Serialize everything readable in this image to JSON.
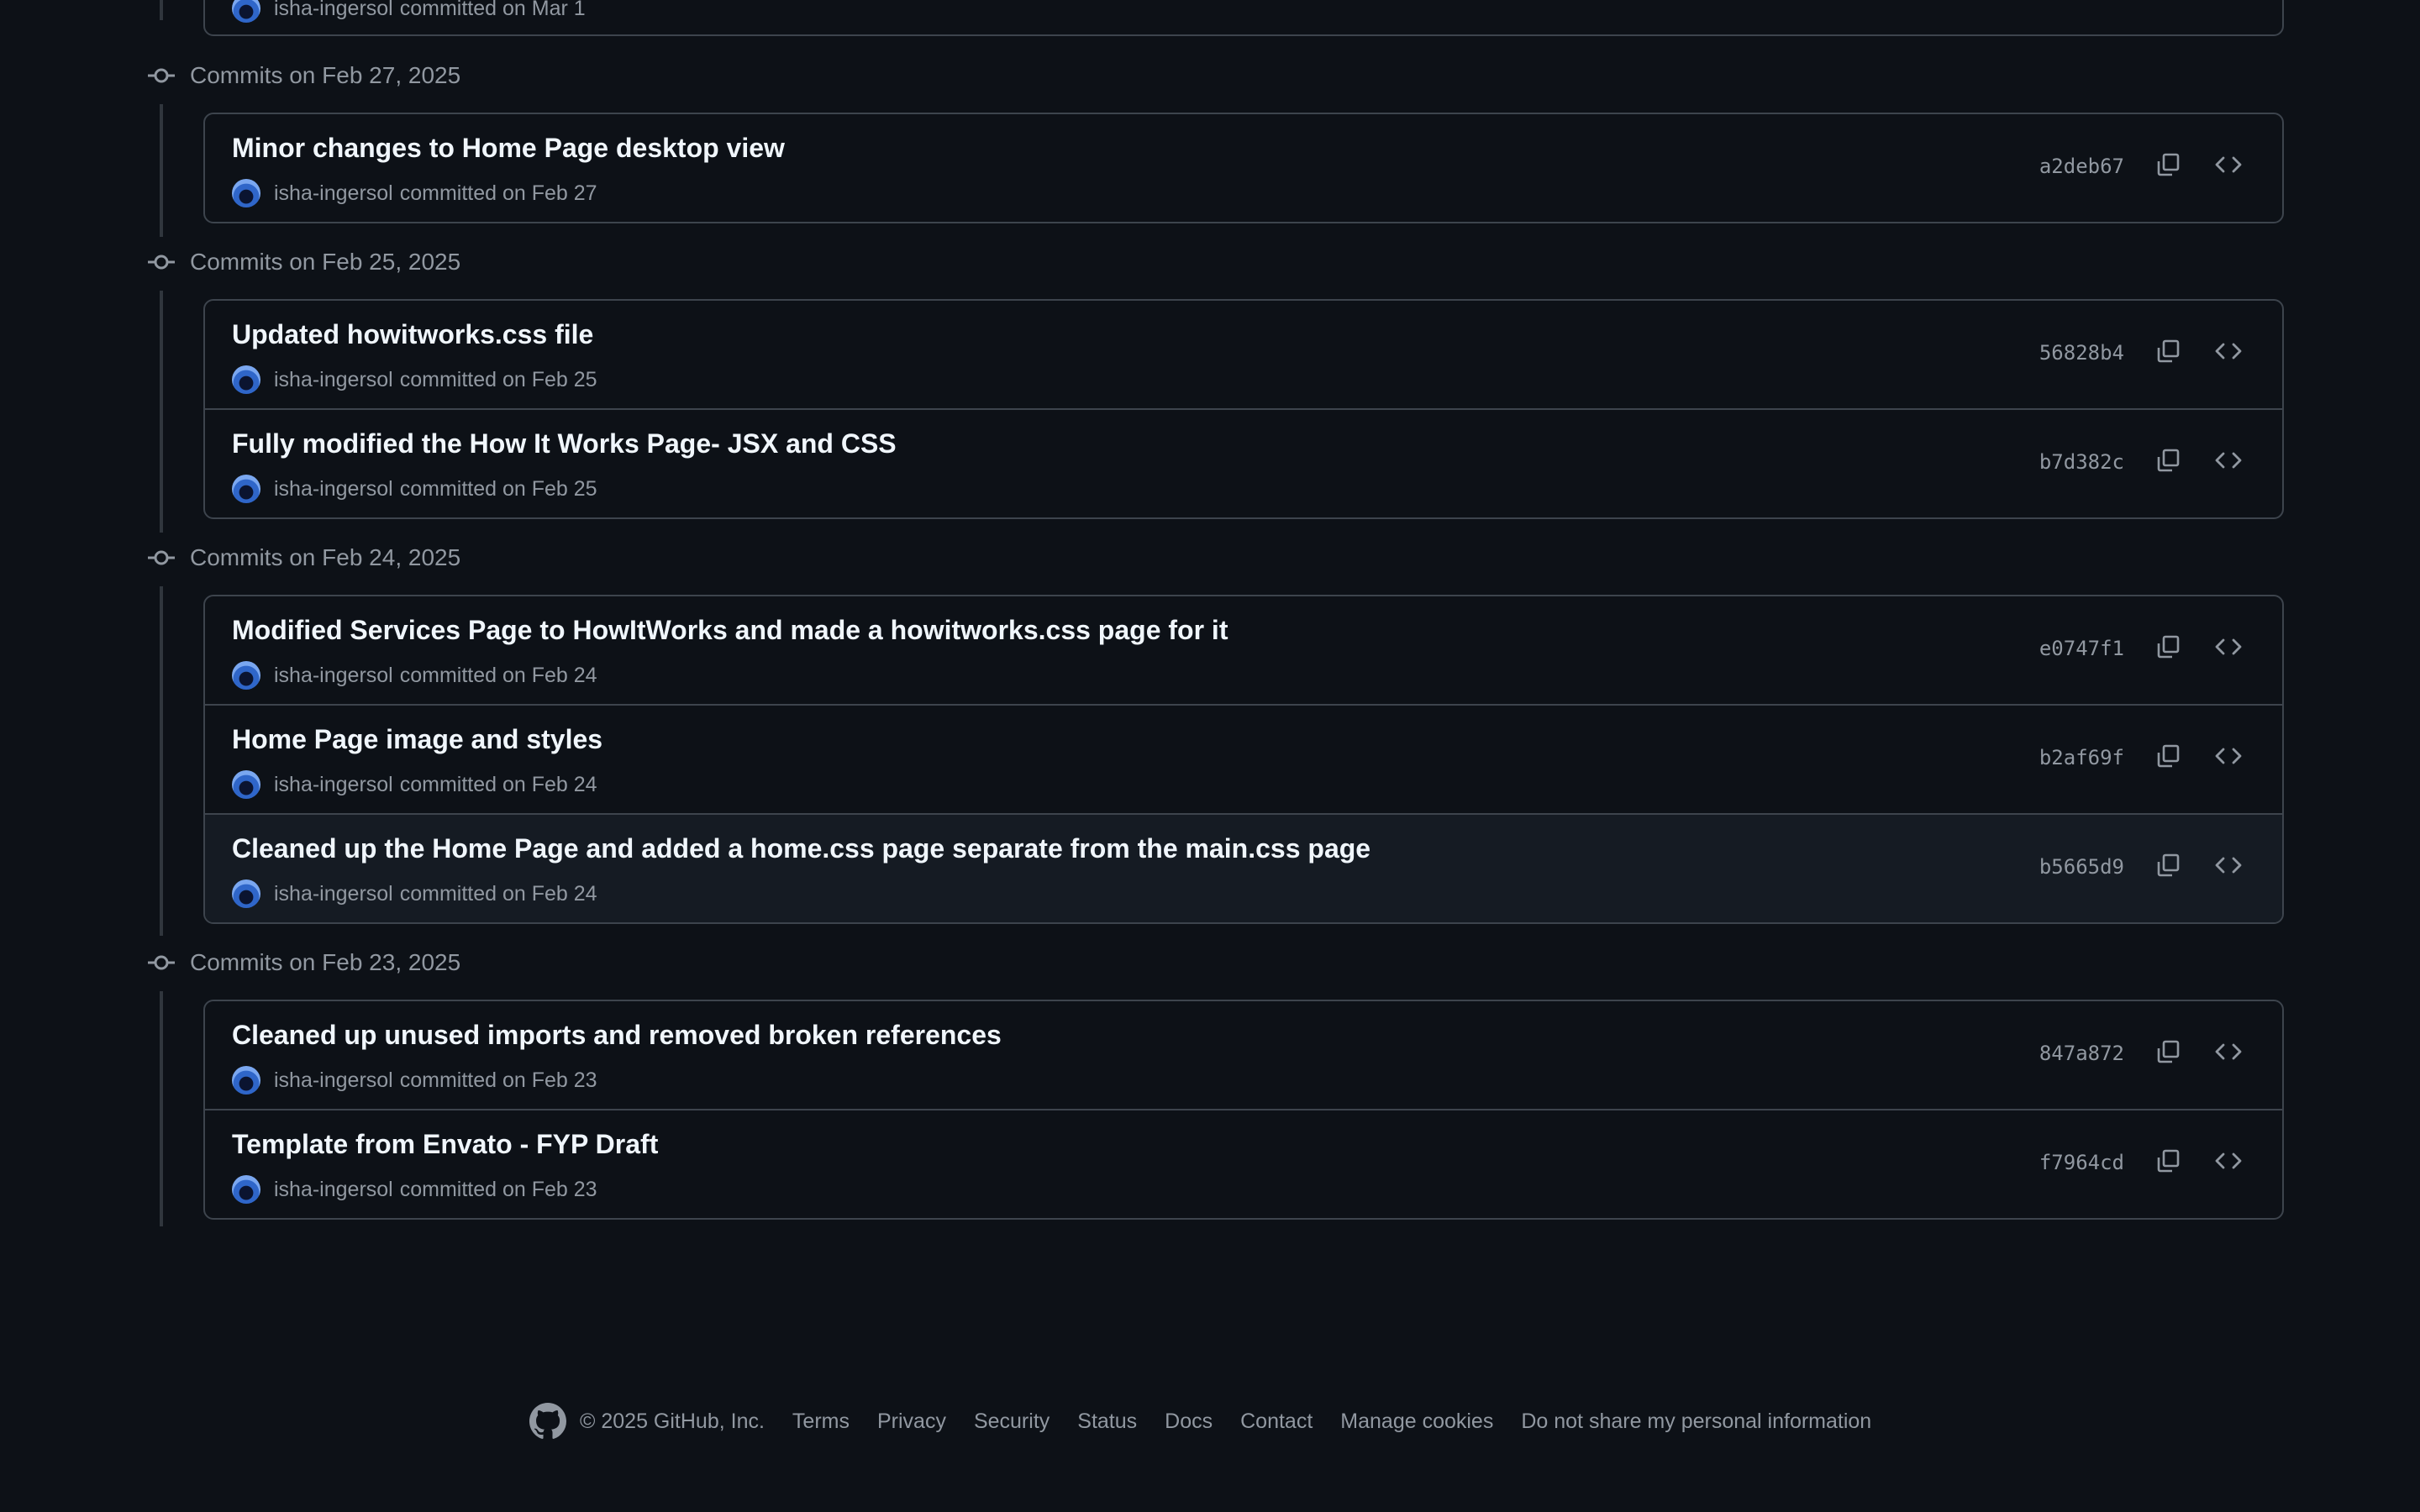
{
  "top_partial": {
    "author": "isha-ingersol",
    "committed_text": "committed on Mar 1"
  },
  "groups": [
    {
      "title": "Commits on Feb 27, 2025",
      "commits": [
        {
          "message": "Minor changes to Home Page desktop view",
          "author": "isha-ingersol",
          "committed_text": "committed on Feb 27",
          "sha": "a2deb67"
        }
      ]
    },
    {
      "title": "Commits on Feb 25, 2025",
      "commits": [
        {
          "message": "Updated howitworks.css file",
          "author": "isha-ingersol",
          "committed_text": "committed on Feb 25",
          "sha": "56828b4"
        },
        {
          "message": "Fully modified the How It Works Page- JSX and CSS",
          "author": "isha-ingersol",
          "committed_text": "committed on Feb 25",
          "sha": "b7d382c"
        }
      ]
    },
    {
      "title": "Commits on Feb 24, 2025",
      "commits": [
        {
          "message": "Modified Services Page to HowItWorks and made a howitworks.css page for it",
          "author": "isha-ingersol",
          "committed_text": "committed on Feb 24",
          "sha": "e0747f1"
        },
        {
          "message": "Home Page image and styles",
          "author": "isha-ingersol",
          "committed_text": "committed on Feb 24",
          "sha": "b2af69f"
        },
        {
          "message": "Cleaned up the Home Page and added a home.css page separate from the main.css page",
          "author": "isha-ingersol",
          "committed_text": "committed on Feb 24",
          "sha": "b5665d9"
        }
      ]
    },
    {
      "title": "Commits on Feb 23, 2025",
      "commits": [
        {
          "message": "Cleaned up unused imports and removed broken references",
          "author": "isha-ingersol",
          "committed_text": "committed on Feb 23",
          "sha": "847a872"
        },
        {
          "message": "Template from Envato - FYP Draft",
          "author": "isha-ingersol",
          "committed_text": "committed on Feb 23",
          "sha": "f7964cd"
        }
      ]
    }
  ],
  "footer": {
    "copyright": "© 2025 GitHub, Inc.",
    "links": [
      "Terms",
      "Privacy",
      "Security",
      "Status",
      "Docs",
      "Contact",
      "Manage cookies",
      "Do not share my personal information"
    ]
  },
  "icons": {
    "commit": "git-commit-icon",
    "copy": "copy-icon",
    "browse": "code-icon",
    "footer_logo": "github-logo-icon"
  },
  "colors": {
    "background": "#0d1117",
    "border": "#3d444d",
    "muted_text": "#9198a1",
    "title_text": "#f0f6fc"
  }
}
